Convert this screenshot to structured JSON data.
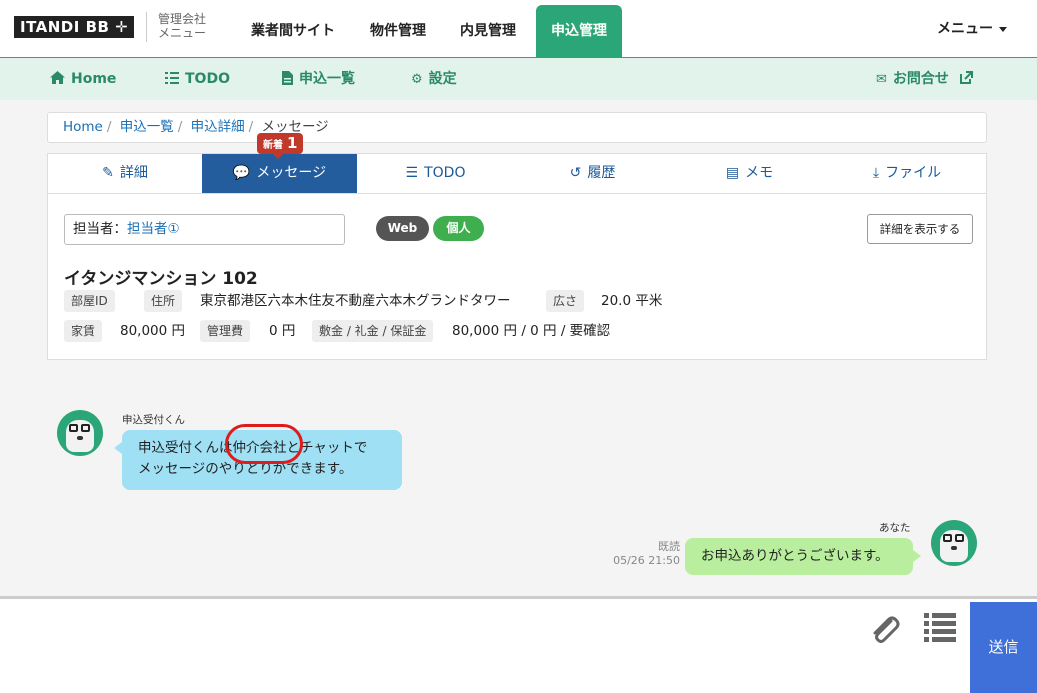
{
  "header": {
    "logo": "ITANDI BB ✛",
    "logo_sub": "管理会社 メニュー",
    "nav": [
      "業者間サイト",
      "物件管理",
      "内見管理",
      "申込管理"
    ],
    "menu": "メニュー"
  },
  "subnav": {
    "home": "Home",
    "todo": "TODO",
    "list": "申込一覧",
    "settings": "設定",
    "contact": "お問合せ"
  },
  "breadcrumb": {
    "items": [
      "Home",
      "申込一覧",
      "申込詳細"
    ],
    "current": "メッセージ"
  },
  "badge": {
    "label": "新着",
    "count": "1"
  },
  "tabs": [
    "詳細",
    "メッセージ",
    "TODO",
    "履歴",
    "メモ",
    "ファイル"
  ],
  "card": {
    "assignee_label": "担当者：",
    "assignee_value": "担当者①",
    "pill_web": "Web",
    "pill_personal": "個人",
    "detail_button": "詳細を表示する",
    "property_name": "イタンジマンション 102",
    "room_id_label": "部屋ID",
    "address_label": "住所",
    "address_value": "東京都港区六本木住友不動産六本木グランドタワー",
    "area_label": "広さ",
    "area_value": "20.0 平米",
    "rent_label": "家賃",
    "rent_value": "80,000 円",
    "fee_label": "管理費",
    "fee_value": "0 円",
    "deposit_label": "敷金 / 礼金 / 保証金",
    "deposit_value": "80,000 円 / 0 円 / 要確認"
  },
  "chat": {
    "incoming_sender": "申込受付くん",
    "incoming_line1": "申込受付くんは仲介会社とチャットで",
    "incoming_line2": "メッセージのやりとりができます。",
    "outgoing_sender": "あなた",
    "outgoing_text": "お申込ありがとうございます。",
    "read_label": "既読",
    "timestamp": "05/26 21:50"
  },
  "input": {
    "send": "送信",
    "attach_icon": "paperclip-icon",
    "template_icon": "list-icon"
  },
  "colors": {
    "brand_green": "#2aa678",
    "tab_active": "#245d9d",
    "send_blue": "#3f6fd8",
    "badge_red": "#c0392b"
  }
}
